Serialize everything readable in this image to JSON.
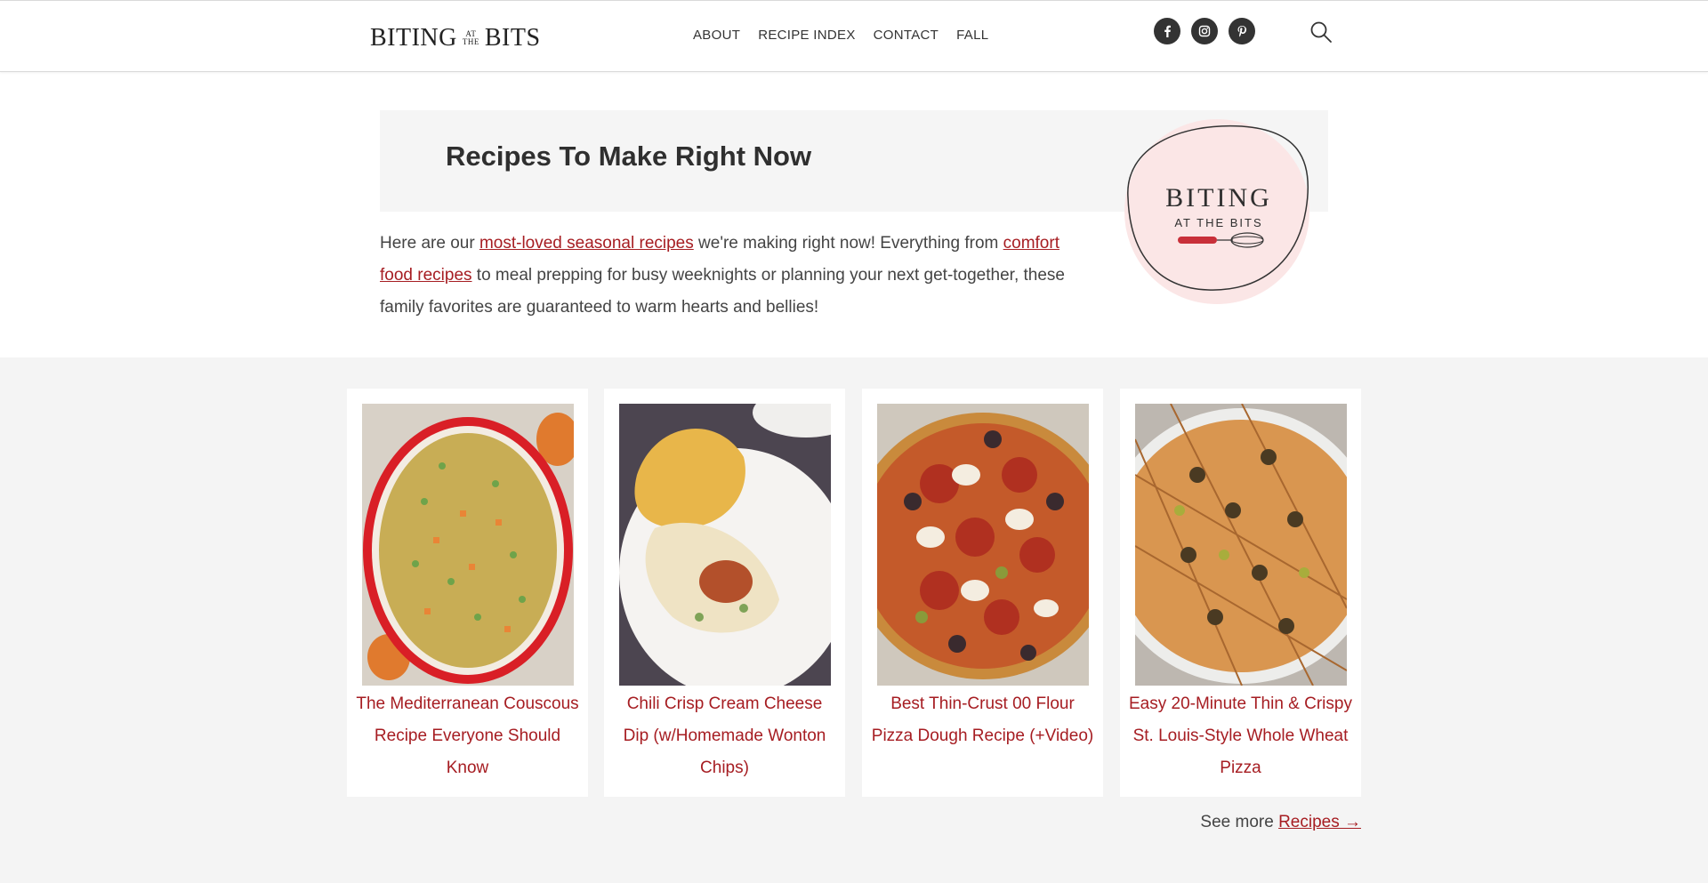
{
  "header": {
    "logo": {
      "word1": "BITING",
      "small_top": "AT",
      "small_bottom": "THE",
      "word2": "BITS"
    },
    "nav": [
      {
        "label": "ABOUT"
      },
      {
        "label": "RECIPE INDEX"
      },
      {
        "label": "CONTACT"
      },
      {
        "label": "FALL"
      }
    ],
    "social": [
      {
        "icon": "facebook-icon",
        "glyph": "f"
      },
      {
        "icon": "instagram-icon",
        "glyph": "◎"
      },
      {
        "icon": "pinterest-icon",
        "glyph": "P"
      }
    ],
    "search_icon": "search-icon"
  },
  "intro": {
    "title": "Recipes To Make Right Now",
    "text_1": "Here are our ",
    "link_1": "most-loved seasonal recipes",
    "text_2": " we're making right now! Everything from ",
    "link_2": "comfort food recipes",
    "text_3": " to meal prepping for busy weeknights or planning your next get-together, these family favorites are guaranteed to warm hearts and bellies!",
    "badge": {
      "line1": "BITING",
      "line2": "AT THE BITS"
    }
  },
  "recipes": [
    {
      "title": "The Mediterranean Couscous Recipe Everyone Should Know"
    },
    {
      "title": "Chili Crisp Cream Cheese Dip (w/Homemade Wonton Chips)"
    },
    {
      "title": "Best Thin-Crust 00 Flour Pizza Dough Recipe (+Video)"
    },
    {
      "title": "Easy 20-Minute Thin & Crispy St. Louis-Style Whole Wheat Pizza"
    }
  ],
  "see_more": {
    "text": "See more ",
    "link": "Recipes →"
  },
  "colors": {
    "accent": "#a61d22",
    "section_bg": "#f4f4f4",
    "band_bg": "#f5f5f5"
  }
}
